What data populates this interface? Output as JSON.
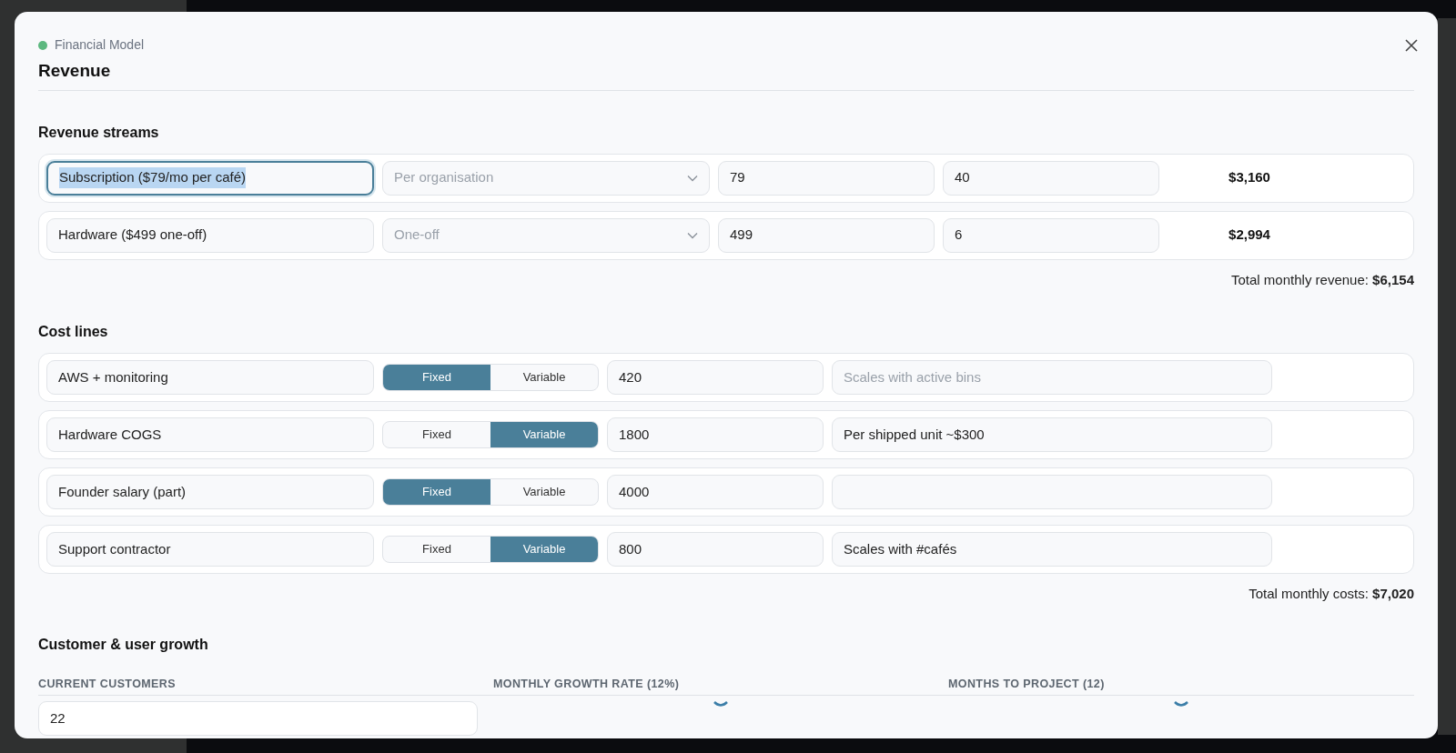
{
  "modal": {
    "status": {
      "label": "Financial Model",
      "color": "#5cb87f"
    },
    "title": "Revenue"
  },
  "revenue_streams": {
    "heading": "Revenue streams",
    "rows": [
      {
        "name": "Subscription ($79/mo per café)",
        "focused": true,
        "billing": "Per organisation",
        "price": "79",
        "quantity": "40",
        "total": "$3,160"
      },
      {
        "name": "Hardware ($499 one-off)",
        "focused": false,
        "billing": "One-off",
        "price": "499",
        "quantity": "6",
        "total": "$2,994"
      }
    ],
    "summary": "Total monthly revenue: **$6,154**"
  },
  "cost_lines": {
    "heading": "Cost lines",
    "rows": [
      {
        "name": "AWS + monitoring",
        "types": [
          {
            "label": "Fixed",
            "selected": true
          },
          {
            "label": "Variable",
            "selected": false
          }
        ],
        "amount": "420",
        "note_placeholder": "Scales with active bins"
      },
      {
        "name": "Hardware COGS",
        "types": [
          {
            "label": "Fixed",
            "selected": false
          },
          {
            "label": "Variable",
            "selected": true
          }
        ],
        "amount": "1800",
        "note": "Per shipped unit ~$300"
      },
      {
        "name": "Founder salary (part)",
        "types": [
          {
            "label": "Fixed",
            "selected": true
          },
          {
            "label": "Variable",
            "selected": false
          }
        ],
        "amount": "4000"
      },
      {
        "name": "Support contractor",
        "types": [
          {
            "label": "Fixed",
            "selected": false
          },
          {
            "label": "Variable",
            "selected": true
          }
        ],
        "amount": "800",
        "note": "Scales with #cafés"
      }
    ],
    "summary": "Total monthly costs: **$7,020**"
  },
  "growth": {
    "heading": "Customer & user growth",
    "columns": [
      {
        "label": "CURRENT CUSTOMERS",
        "kind": "input",
        "value": "22"
      },
      {
        "label": "MONTHLY GROWTH RATE (12%)",
        "kind": "slider"
      },
      {
        "label": "MONTHS TO PROJECT (12)",
        "kind": "slider"
      }
    ]
  }
}
